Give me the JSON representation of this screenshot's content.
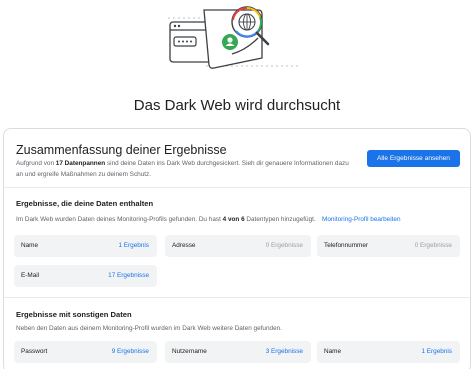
{
  "page": {
    "title": "Das Dark Web wird durchsucht"
  },
  "summary": {
    "title": "Zusammenfassung deiner Ergebnisse",
    "desc_prefix": "Aufgrund von ",
    "desc_bold": "17 Datenpannen",
    "desc_suffix": " sind deine Daten ins Dark Web durchgesickert. Sieh dir genauere Informationen dazu an und ergreife Maßnahmen zu deinem Schutz.",
    "button_label": "Alle Ergebnisse ansehen"
  },
  "profile_section": {
    "title": "Ergebnisse, die deine Daten enthalten",
    "desc_prefix": "Im Dark Web wurden Daten deines Monitoring-Profils gefunden. Du hast ",
    "desc_bold": "4 von 6",
    "desc_suffix": " Datentypen hinzugefügt.",
    "edit_link": "Monitoring-Profil bearbeiten",
    "tiles": [
      {
        "label": "Name",
        "count": "1 Ergebnis",
        "muted": false
      },
      {
        "label": "Adresse",
        "count": "0 Ergebnisse",
        "muted": true
      },
      {
        "label": "Telefonnummer",
        "count": "0 Ergebnisse",
        "muted": true
      },
      {
        "label": "E-Mail",
        "count": "17 Ergebnisse",
        "muted": false
      }
    ]
  },
  "other_section": {
    "title": "Ergebnisse mit sonstigen Daten",
    "desc": "Neben den Daten aus deinem Monitoring-Profil wurden im Dark Web weitere Daten gefunden.",
    "tiles": [
      {
        "label": "Passwort",
        "count": "9 Ergebnisse",
        "muted": false
      },
      {
        "label": "Nutzername",
        "count": "3 Ergebnisse",
        "muted": false
      },
      {
        "label": "Name",
        "count": "1 Ergebnis",
        "muted": false
      }
    ]
  },
  "colors": {
    "accent": "#1a73e8",
    "muted": "#9aa0a6",
    "tile_bg": "#f1f3f4"
  },
  "icons": {
    "hero": "dark-web-scan-illustration",
    "magnifier": "magnifier-icon",
    "globe": "globe-icon",
    "password": "password-field-icon"
  }
}
